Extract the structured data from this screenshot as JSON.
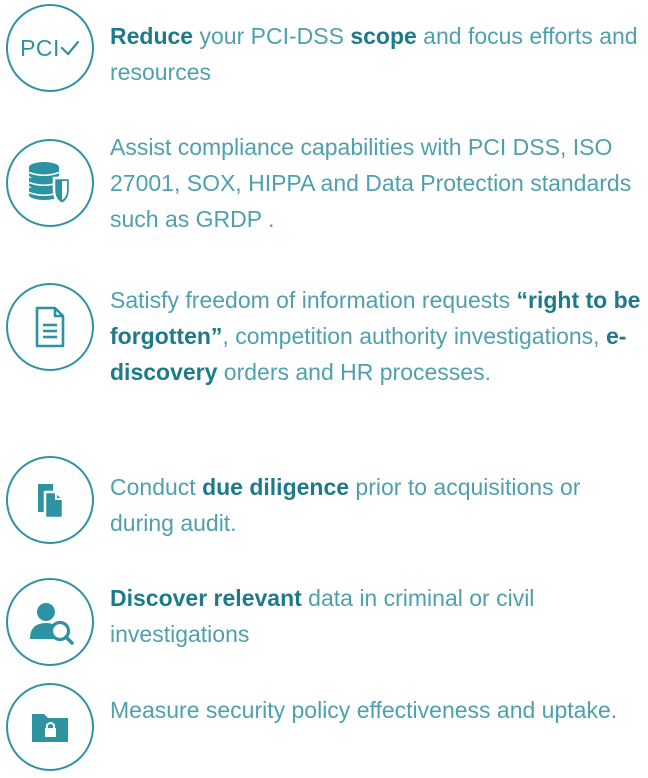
{
  "colors": {
    "accent": "#2d93a3",
    "text": "#4fa0ae",
    "emphasis": "#1d7a8b"
  },
  "items": [
    {
      "icon": "pci-check-icon",
      "icon_text": "PCI",
      "parts": [
        {
          "text": "Reduce",
          "bold": true
        },
        {
          "text": " your PCI-DSS ",
          "bold": false
        },
        {
          "text": "scope",
          "bold": true
        },
        {
          "text": " and focus efforts and resources",
          "bold": false
        }
      ]
    },
    {
      "icon": "database-shield-icon",
      "parts": [
        {
          "text": "Assist compliance capabilities with PCI DSS, ISO 27001, SOX, HIPPA and Data Protection standards such as GRDP .",
          "bold": false
        }
      ]
    },
    {
      "icon": "document-icon",
      "parts": [
        {
          "text": "Satisfy freedom of information requests ",
          "bold": false
        },
        {
          "text": "“right to be forgotten”",
          "bold": true
        },
        {
          "text": ", competition authority investigations, ",
          "bold": false
        },
        {
          "text": "e-discovery",
          "bold": true
        },
        {
          "text": " orders and HR processes.",
          "bold": false
        }
      ]
    },
    {
      "icon": "copy-documents-icon",
      "parts": [
        {
          "text": "Conduct ",
          "bold": false
        },
        {
          "text": "due diligence",
          "bold": true
        },
        {
          "text": " prior to acquisitions or during audit.",
          "bold": false
        }
      ]
    },
    {
      "icon": "user-search-icon",
      "parts": [
        {
          "text": "Discover relevant",
          "bold": true
        },
        {
          "text": " data in criminal or civil investigations",
          "bold": false
        }
      ]
    },
    {
      "icon": "locked-folder-icon",
      "parts": [
        {
          "text": "Measure security policy effectiveness and uptake.",
          "bold": false
        }
      ]
    }
  ]
}
